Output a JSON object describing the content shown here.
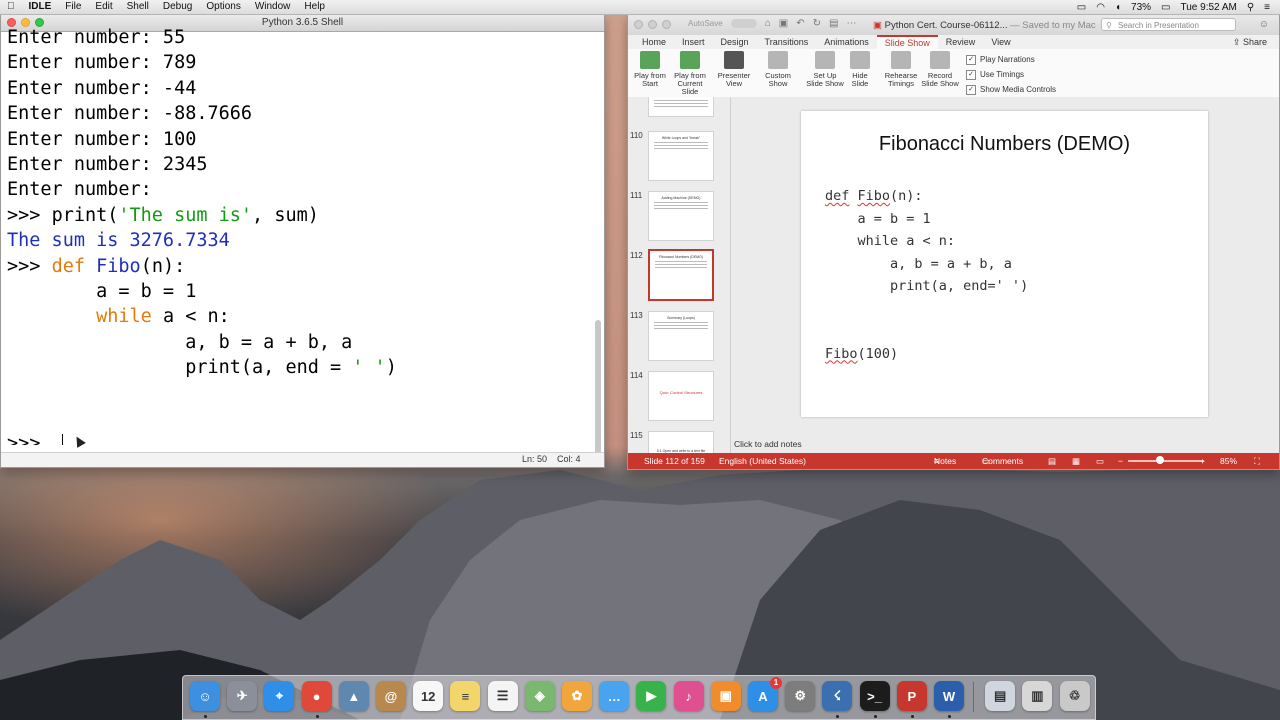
{
  "menubar": {
    "app_name": "IDLE",
    "items": [
      "File",
      "Edit",
      "Shell",
      "Debug",
      "Options",
      "Window",
      "Help"
    ],
    "battery": "73%",
    "clock": "Tue 9:52 AM"
  },
  "idle": {
    "title": "Python 3.6.5 Shell",
    "status_line": "Ln: 50",
    "status_col": "Col: 4",
    "lines": [
      {
        "parts": [
          {
            "t": "Enter number: 55",
            "c": ""
          }
        ]
      },
      {
        "parts": [
          {
            "t": "Enter number: 789",
            "c": ""
          }
        ]
      },
      {
        "parts": [
          {
            "t": "Enter number: -44",
            "c": ""
          }
        ]
      },
      {
        "parts": [
          {
            "t": "Enter number: -88.7666",
            "c": ""
          }
        ]
      },
      {
        "parts": [
          {
            "t": "Enter number: 100",
            "c": ""
          }
        ]
      },
      {
        "parts": [
          {
            "t": "Enter number: 2345",
            "c": ""
          }
        ]
      },
      {
        "parts": [
          {
            "t": "Enter number: ",
            "c": ""
          }
        ]
      },
      {
        "parts": [
          {
            "t": ">>> ",
            "c": ""
          },
          {
            "t": "print(",
            "c": ""
          },
          {
            "t": "'The sum is'",
            "c": "c-str"
          },
          {
            "t": ", sum)",
            "c": ""
          }
        ]
      },
      {
        "parts": [
          {
            "t": "The sum is 3276.7334",
            "c": "c-out"
          }
        ]
      },
      {
        "parts": [
          {
            "t": ">>> ",
            "c": ""
          },
          {
            "t": "def",
            "c": "c-kw"
          },
          {
            "t": " ",
            "c": ""
          },
          {
            "t": "Fibo",
            "c": "c-out"
          },
          {
            "t": "(n):",
            "c": ""
          }
        ]
      },
      {
        "parts": [
          {
            "t": "        a = b = 1",
            "c": ""
          }
        ]
      },
      {
        "parts": [
          {
            "t": "        ",
            "c": ""
          },
          {
            "t": "while",
            "c": "c-kw"
          },
          {
            "t": " a < n:",
            "c": ""
          }
        ]
      },
      {
        "parts": [
          {
            "t": "                a, b = a + b, a",
            "c": ""
          }
        ]
      },
      {
        "parts": [
          {
            "t": "                print(a, end = ",
            "c": ""
          },
          {
            "t": "' '",
            "c": "c-str"
          },
          {
            "t": ")",
            "c": ""
          }
        ]
      },
      {
        "parts": [
          {
            "t": "",
            "c": ""
          }
        ]
      },
      {
        "parts": [
          {
            "t": "",
            "c": ""
          }
        ]
      },
      {
        "parts": [
          {
            "t": ">>> ",
            "c": ""
          }
        ]
      }
    ]
  },
  "ppt": {
    "quick_toggle": "AutoSave",
    "doc_title": "Python Cert. Course-06112...",
    "saved": "— Saved to my Mac",
    "search_placeholder": "Search in Presentation",
    "tabs": [
      "Home",
      "Insert",
      "Design",
      "Transitions",
      "Animations",
      "Slide Show",
      "Review",
      "View"
    ],
    "active_tab": "Slide Show",
    "share": "Share",
    "ribbon_buttons": [
      {
        "label1": "Play from",
        "label2": "Start",
        "color": "#5aa35a"
      },
      {
        "label1": "Play from",
        "label2": "Current Slide",
        "color": "#5aa35a"
      },
      {
        "label1": "Presenter",
        "label2": "View",
        "color": "#555555"
      },
      {
        "label1": "Custom",
        "label2": "Show",
        "color": "#8a8a8a"
      },
      {
        "label1": "Set Up",
        "label2": "Slide Show",
        "color": "#8a8a8a"
      },
      {
        "label1": "Hide",
        "label2": "Slide",
        "color": "#8a8a8a"
      },
      {
        "label1": "Rehearse",
        "label2": "Timings",
        "color": "#8a8a8a"
      },
      {
        "label1": "Record",
        "label2": "Slide Show",
        "color": "#8a8a8a"
      }
    ],
    "checkboxes": [
      "Play Narrations",
      "Use Timings",
      "Show Media Controls"
    ],
    "thumbnails": [
      {
        "num": "110",
        "title": "While Loops and \"break\""
      },
      {
        "num": "111",
        "title": "Adding Machine (DEMO)"
      },
      {
        "num": "112",
        "title": "Fibonacci Numbers (DEMO)"
      },
      {
        "num": "113",
        "title": "Summary (Loops)"
      },
      {
        "num": "114",
        "title": "Quiz: Control Structures"
      },
      {
        "num": "115",
        "title": "5.1 Open and write to a text file"
      }
    ],
    "slide": {
      "title": "Fibonacci Numbers (DEMO)",
      "code": [
        {
          "pre": "",
          "sq": "def",
          "mid": " ",
          "sq2": "Fibo",
          "post": "(n):"
        },
        {
          "pre": "    a = b = 1",
          "sq": "",
          "mid": "",
          "sq2": "",
          "post": ""
        },
        {
          "pre": "    while a < n:",
          "sq": "",
          "mid": "",
          "sq2": "",
          "post": ""
        },
        {
          "pre": "        a, b = a + b, a",
          "sq": "",
          "mid": "",
          "sq2": "",
          "post": ""
        },
        {
          "pre": "        print(a, end=' ')",
          "sq": "",
          "mid": "",
          "sq2": "",
          "post": ""
        },
        {
          "pre": "",
          "sq": "",
          "mid": "",
          "sq2": "",
          "post": ""
        },
        {
          "pre": "",
          "sq": "",
          "mid": "",
          "sq2": "",
          "post": ""
        },
        {
          "pre": "",
          "sq": "Fibo",
          "mid": "",
          "sq2": "",
          "post": "(100)"
        }
      ]
    },
    "notes_placeholder": "Click to add notes",
    "status": {
      "slide_of": "Slide 112 of 159",
      "language": "English (United States)",
      "notes": "Notes",
      "comments": "Comments",
      "zoom": "85%"
    }
  },
  "dock": {
    "apps": [
      {
        "name": "finder-icon",
        "glyph": "☺",
        "color": "#3d8fe0"
      },
      {
        "name": "launchpad-icon",
        "glyph": "✈",
        "color": "#8a8f99"
      },
      {
        "name": "safari-icon",
        "glyph": "⌖",
        "color": "#2f8ee8"
      },
      {
        "name": "chrome-icon",
        "glyph": "●",
        "color": "#e0493a"
      },
      {
        "name": "preview-icon",
        "glyph": "▲",
        "color": "#5e88b0"
      },
      {
        "name": "contacts-icon",
        "glyph": "@",
        "color": "#b8894f"
      },
      {
        "name": "calendar-icon",
        "glyph": "12",
        "color": "#f7f7f7"
      },
      {
        "name": "notes-icon",
        "glyph": "≡",
        "color": "#f2d56b"
      },
      {
        "name": "reminders-icon",
        "glyph": "☰",
        "color": "#f4f4f4"
      },
      {
        "name": "maps-icon",
        "glyph": "◈",
        "color": "#7bb86f"
      },
      {
        "name": "photos-icon",
        "glyph": "✿",
        "color": "#f0a63c"
      },
      {
        "name": "messages-icon",
        "glyph": "…",
        "color": "#4aa3ee"
      },
      {
        "name": "facetime-icon",
        "glyph": "▶",
        "color": "#38b24a"
      },
      {
        "name": "itunes-icon",
        "glyph": "♪",
        "color": "#e04f8f"
      },
      {
        "name": "ibooks-icon",
        "glyph": "▣",
        "color": "#f08c2b"
      },
      {
        "name": "appstore-icon",
        "glyph": "A",
        "color": "#2d8fe6"
      },
      {
        "name": "system-preferences-icon",
        "glyph": "⚙",
        "color": "#7d7d7d"
      },
      {
        "name": "python-idle-icon",
        "glyph": "☇",
        "color": "#3b6fb0"
      },
      {
        "name": "terminal-icon",
        "glyph": ">_",
        "color": "#1c1c1c"
      },
      {
        "name": "powerpoint-icon",
        "glyph": "P",
        "color": "#c8372d"
      },
      {
        "name": "word-icon",
        "glyph": "W",
        "color": "#2c5fab"
      },
      {
        "name": "downloads-folder-icon",
        "glyph": "▤",
        "color": "#cfd6de"
      },
      {
        "name": "documents-stack-icon",
        "glyph": "▥",
        "color": "#d7d7d7"
      },
      {
        "name": "trash-icon",
        "glyph": "♲",
        "color": "#c9c9c9"
      }
    ],
    "appstore_badge": "1"
  }
}
